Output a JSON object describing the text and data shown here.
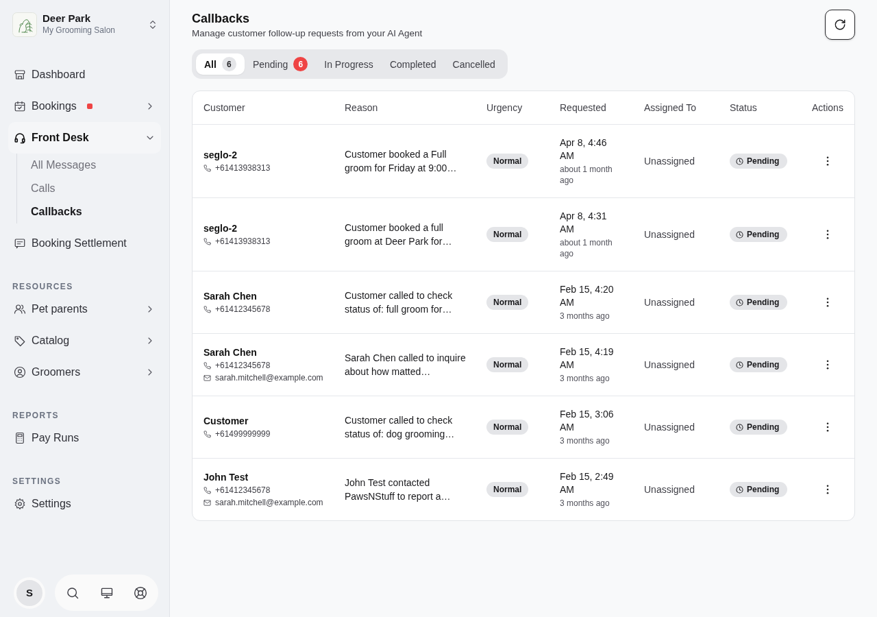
{
  "sidebar": {
    "business": {
      "name": "Deer Park",
      "subtitle": "My Grooming Salon"
    },
    "sections": [
      {
        "items": [
          {
            "label": "Dashboard",
            "kind": "link",
            "selected": false,
            "alert_dot": false
          },
          {
            "label": "Bookings",
            "kind": "menu",
            "selected": false,
            "alert_dot": true,
            "expanded": false
          },
          {
            "label": "Front Desk",
            "kind": "menu",
            "selected": true,
            "alert_dot": false,
            "expanded": true,
            "children": [
              {
                "label": "All Messages",
                "selected": false
              },
              {
                "label": "Calls",
                "selected": false
              },
              {
                "label": "Callbacks",
                "selected": true
              }
            ]
          },
          {
            "label": "Booking Settlement",
            "kind": "link",
            "selected": false,
            "alert_dot": false
          }
        ]
      },
      {
        "heading": "RESOURCES",
        "items": [
          {
            "label": "Pet parents",
            "kind": "menu",
            "selected": false,
            "alert_dot": false,
            "expanded": false
          },
          {
            "label": "Catalog",
            "kind": "menu",
            "selected": false,
            "alert_dot": false,
            "expanded": false
          },
          {
            "label": "Groomers",
            "kind": "menu",
            "selected": false,
            "alert_dot": false,
            "expanded": false
          }
        ]
      },
      {
        "heading": "REPORTS",
        "items": [
          {
            "label": "Pay Runs",
            "kind": "link",
            "selected": false,
            "alert_dot": false
          }
        ]
      },
      {
        "heading": "SETTINGS",
        "items": [
          {
            "label": "Settings",
            "kind": "link",
            "selected": false,
            "alert_dot": false
          }
        ]
      }
    ],
    "user": {
      "initial": "S"
    }
  },
  "page": {
    "title": "Callbacks",
    "subtitle": "Manage customer follow-up requests from your AI Agent"
  },
  "tabs": [
    {
      "label": "All",
      "count": {
        "text": "6",
        "color": "#e4e5e8"
      },
      "selected": true
    },
    {
      "label": "Pending",
      "count": {
        "text": "6",
        "color": "#ef4444"
      },
      "selected": false
    },
    {
      "label": "In Progress",
      "selected": false
    },
    {
      "label": "Completed",
      "selected": false
    },
    {
      "label": "Cancelled",
      "selected": false
    }
  ],
  "table": {
    "columns": [
      "Customer",
      "Reason",
      "Urgency",
      "Requested",
      "Assigned To",
      "Status",
      "Actions"
    ],
    "rows": [
      {
        "customer": {
          "name": "seglo-2",
          "phone": "+61413938313"
        },
        "reason": "Customer booked a Full groom for Friday at 9:00…",
        "urgency": "Normal",
        "requested": "Apr 8, 4:46 AM",
        "requested_relative": "about 1 month ago",
        "assigned_to": "Unassigned",
        "status": "Pending"
      },
      {
        "customer": {
          "name": "seglo-2",
          "phone": "+61413938313"
        },
        "reason": "Customer booked a full groom at Deer Park for…",
        "urgency": "Normal",
        "requested": "Apr 8, 4:31 AM",
        "requested_relative": "about 1 month ago",
        "assigned_to": "Unassigned",
        "status": "Pending"
      },
      {
        "customer": {
          "name": "Sarah Chen",
          "phone": "+61412345678"
        },
        "reason": "Customer called to check status of: full groom for…",
        "urgency": "Normal",
        "requested": "Feb 15, 4:20 AM",
        "requested_relative": "3 months ago",
        "assigned_to": "Unassigned",
        "status": "Pending"
      },
      {
        "customer": {
          "name": "Sarah Chen",
          "phone": "+61412345678",
          "email": "sarah.mitchell@example.com"
        },
        "reason": "Sarah Chen called to inquire about how matted…",
        "urgency": "Normal",
        "requested": "Feb 15, 4:19 AM",
        "requested_relative": "3 months ago",
        "assigned_to": "Unassigned",
        "status": "Pending"
      },
      {
        "customer": {
          "name": "Customer",
          "phone": "+61499999999"
        },
        "reason": "Customer called to check status of: dog grooming…",
        "urgency": "Normal",
        "requested": "Feb 15, 3:06 AM",
        "requested_relative": "3 months ago",
        "assigned_to": "Unassigned",
        "status": "Pending"
      },
      {
        "customer": {
          "name": "John Test",
          "phone": "+61412345678",
          "email": "sarah.mitchell@example.com"
        },
        "reason": "John Test contacted PawsNStuff to report a…",
        "urgency": "Normal",
        "requested": "Feb 15, 2:49 AM",
        "requested_relative": "3 months ago",
        "assigned_to": "Unassigned",
        "status": "Pending"
      }
    ]
  }
}
